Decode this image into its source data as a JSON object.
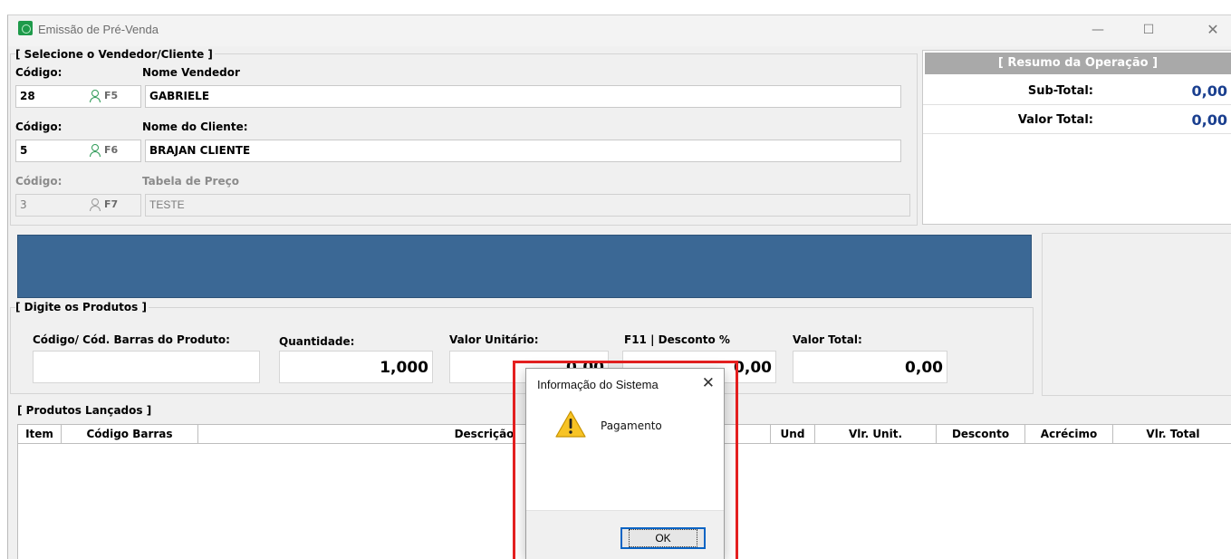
{
  "window": {
    "title": "Emissão de Pré-Venda",
    "controls": {
      "minimize": "—",
      "maximize": "☐",
      "close": "✕"
    }
  },
  "vendor_client": {
    "group_title": "[ Selecione o Vendedor/Cliente ]",
    "seller": {
      "code_label": "Código:",
      "name_label": "Nome Vendedor",
      "code": "28",
      "shortcut": "F5",
      "name": "GABRIELE"
    },
    "client": {
      "code_label": "Código:",
      "name_label": "Nome do Cliente:",
      "code": "5",
      "shortcut": "F6",
      "name": "BRAJAN CLIENTE"
    },
    "price_table": {
      "code_label": "Código:",
      "name_label": "Tabela de Preço",
      "code": "3",
      "shortcut": "F7",
      "name": "TESTE"
    }
  },
  "summary": {
    "title": "[ Resumo da Operação ]",
    "subtotal_label": "Sub-Total:",
    "subtotal_value": "0,00",
    "total_label": "Valor Total:",
    "total_value": "0,00"
  },
  "products_entry": {
    "group_title": "[ Digite os Produtos ]",
    "barcode_label": "Código/ Cód. Barras do Produto:",
    "barcode_value": "",
    "quantity_label": "Quantidade:",
    "quantity_value": "1,000",
    "unit_price_label": "Valor Unitário:",
    "unit_price_value": "0,00",
    "discount_label": "F11 | Desconto %",
    "discount_value": "0,00",
    "total_label": "Valor Total:",
    "total_value": "0,00"
  },
  "launched": {
    "group_title": "[ Produtos Lançados ]",
    "columns": [
      "Item",
      "Código Barras",
      "Descrição",
      "Und",
      "Vlr. Unit.",
      "Desconto",
      "Acrécimo",
      "Vlr. Total"
    ]
  },
  "dialog": {
    "title": "Informação do Sistema",
    "close": "✕",
    "message": "Pagamento",
    "ok_label": "OK",
    "icon": "warning-icon"
  },
  "colors": {
    "blue_bar": "#3b6895",
    "summary_value": "#1a3f8f",
    "highlight": "#e52020",
    "dialog_button_border": "#0a64c4"
  }
}
